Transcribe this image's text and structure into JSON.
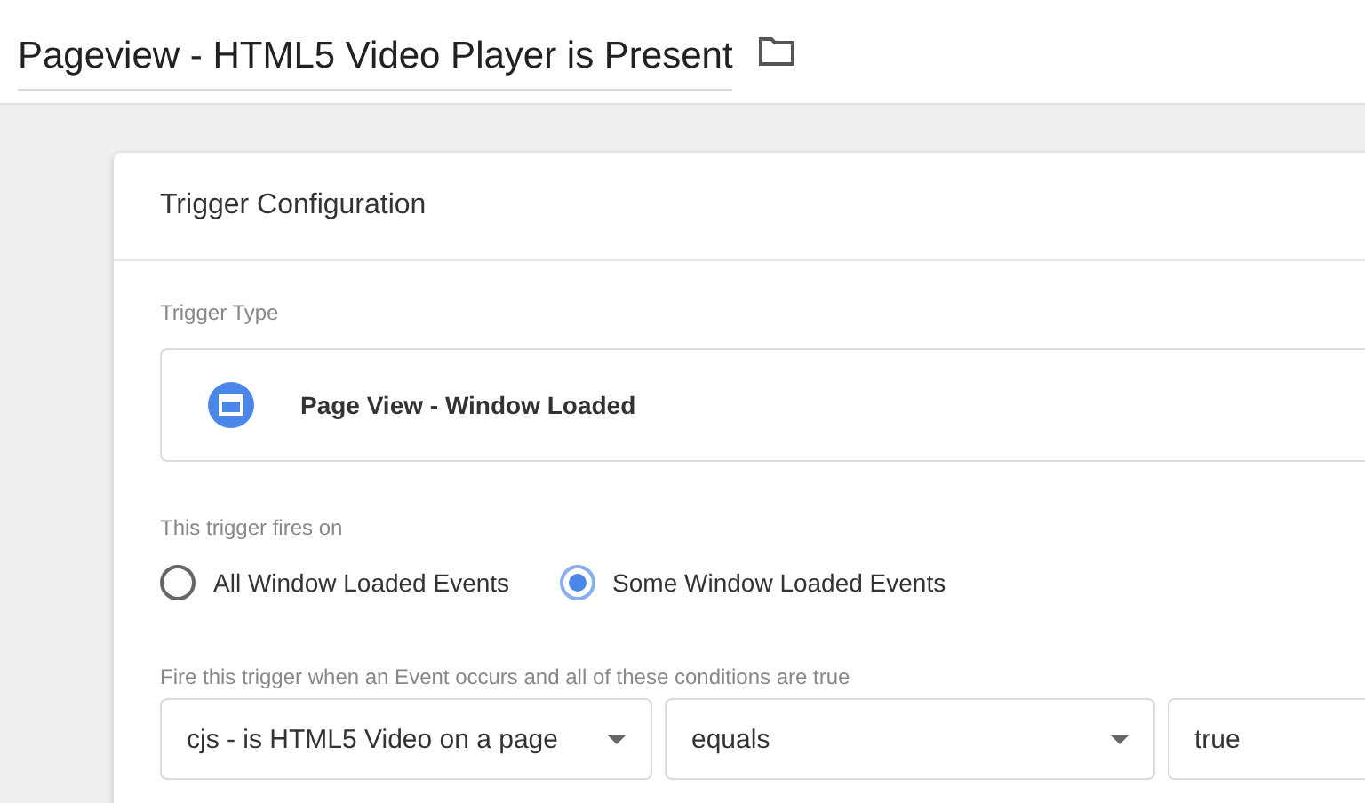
{
  "header": {
    "title": "Pageview - HTML5 Video Player is Present"
  },
  "card": {
    "title": "Trigger Configuration",
    "trigger_type": {
      "label": "Trigger Type",
      "value": "Page View - Window Loaded"
    },
    "fires_on": {
      "label": "This trigger fires on",
      "options": [
        {
          "label": "All Window Loaded Events",
          "selected": false
        },
        {
          "label": "Some Window Loaded Events",
          "selected": true
        }
      ]
    },
    "conditions": {
      "label": "Fire this trigger when an Event occurs and all of these conditions are true",
      "fields": [
        {
          "kind": "select",
          "value": "cjs - is HTML5 Video on a page"
        },
        {
          "kind": "select",
          "value": "equals"
        },
        {
          "kind": "text",
          "value": "true"
        }
      ]
    }
  }
}
